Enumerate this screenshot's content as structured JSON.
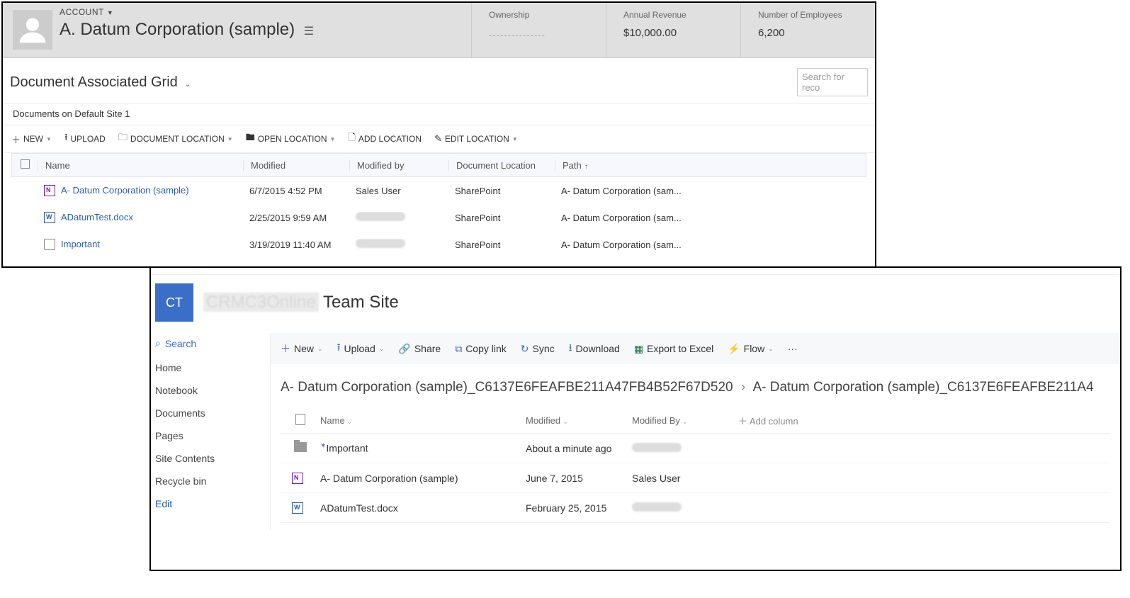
{
  "crm": {
    "account_label": "ACCOUNT",
    "account_name": "A. Datum Corporation (sample)",
    "stats": {
      "ownership": {
        "label": "Ownership",
        "value": "---------------"
      },
      "revenue": {
        "label": "Annual Revenue",
        "value": "$10,000.00"
      },
      "employees": {
        "label": "Number of Employees",
        "value": "6,200"
      }
    },
    "grid_title": "Document Associated Grid",
    "search_placeholder": "Search for reco",
    "location_label": "Documents on Default Site 1",
    "toolbar": {
      "new": "NEW",
      "upload": "UPLOAD",
      "doc_location": "DOCUMENT LOCATION",
      "open_location": "OPEN LOCATION",
      "add_location": "ADD LOCATION",
      "edit_location": "EDIT LOCATION"
    },
    "columns": {
      "name": "Name",
      "modified": "Modified",
      "modified_by": "Modified by",
      "doc_location": "Document Location",
      "path": "Path"
    },
    "rows": [
      {
        "icon": "onenote",
        "name": "A- Datum Corporation (sample)",
        "modified": "6/7/2015 4:52 PM",
        "modified_by": "Sales User",
        "modified_by_blurred": false,
        "location": "SharePoint",
        "path": "A- Datum Corporation (sam..."
      },
      {
        "icon": "word",
        "name": "ADatumTest.docx",
        "modified": "2/25/2015 9:59 AM",
        "modified_by": "",
        "modified_by_blurred": true,
        "location": "SharePoint",
        "path": "A- Datum Corporation (sam..."
      },
      {
        "icon": "page",
        "name": "Important",
        "modified": "3/19/2019 11:40 AM",
        "modified_by": "",
        "modified_by_blurred": true,
        "location": "SharePoint",
        "path": "A- Datum Corporation (sam..."
      }
    ]
  },
  "sp": {
    "logo": "CT",
    "sitename_blurred": "CRMC3Online",
    "sitename_suffix": " Team Site",
    "search": "Search",
    "nav": [
      "Home",
      "Notebook",
      "Documents",
      "Pages",
      "Site Contents",
      "Recycle bin"
    ],
    "nav_edit": "Edit",
    "cmdbar": {
      "new": "New",
      "upload": "Upload",
      "share": "Share",
      "copy_link": "Copy link",
      "sync": "Sync",
      "download": "Download",
      "export": "Export to Excel",
      "flow": "Flow"
    },
    "breadcrumb": {
      "p1": "A- Datum Corporation (sample)_C6137E6FEAFBE211A47FB4B52F67D520",
      "p2": "A- Datum Corporation (sample)_C6137E6FEAFBE211A4"
    },
    "columns": {
      "name": "Name",
      "modified": "Modified",
      "modified_by": "Modified By",
      "add": "Add column"
    },
    "rows": [
      {
        "icon": "folder",
        "name": "Important",
        "name_mark": true,
        "modified": "About a minute ago",
        "modified_by": "",
        "modified_by_blurred": true
      },
      {
        "icon": "onenote",
        "name": "A- Datum Corporation (sample)",
        "name_mark": false,
        "modified": "June 7, 2015",
        "modified_by": "Sales User",
        "modified_by_blurred": false
      },
      {
        "icon": "word",
        "name": "ADatumTest.docx",
        "name_mark": false,
        "modified": "February 25, 2015",
        "modified_by": "",
        "modified_by_blurred": true
      }
    ]
  }
}
